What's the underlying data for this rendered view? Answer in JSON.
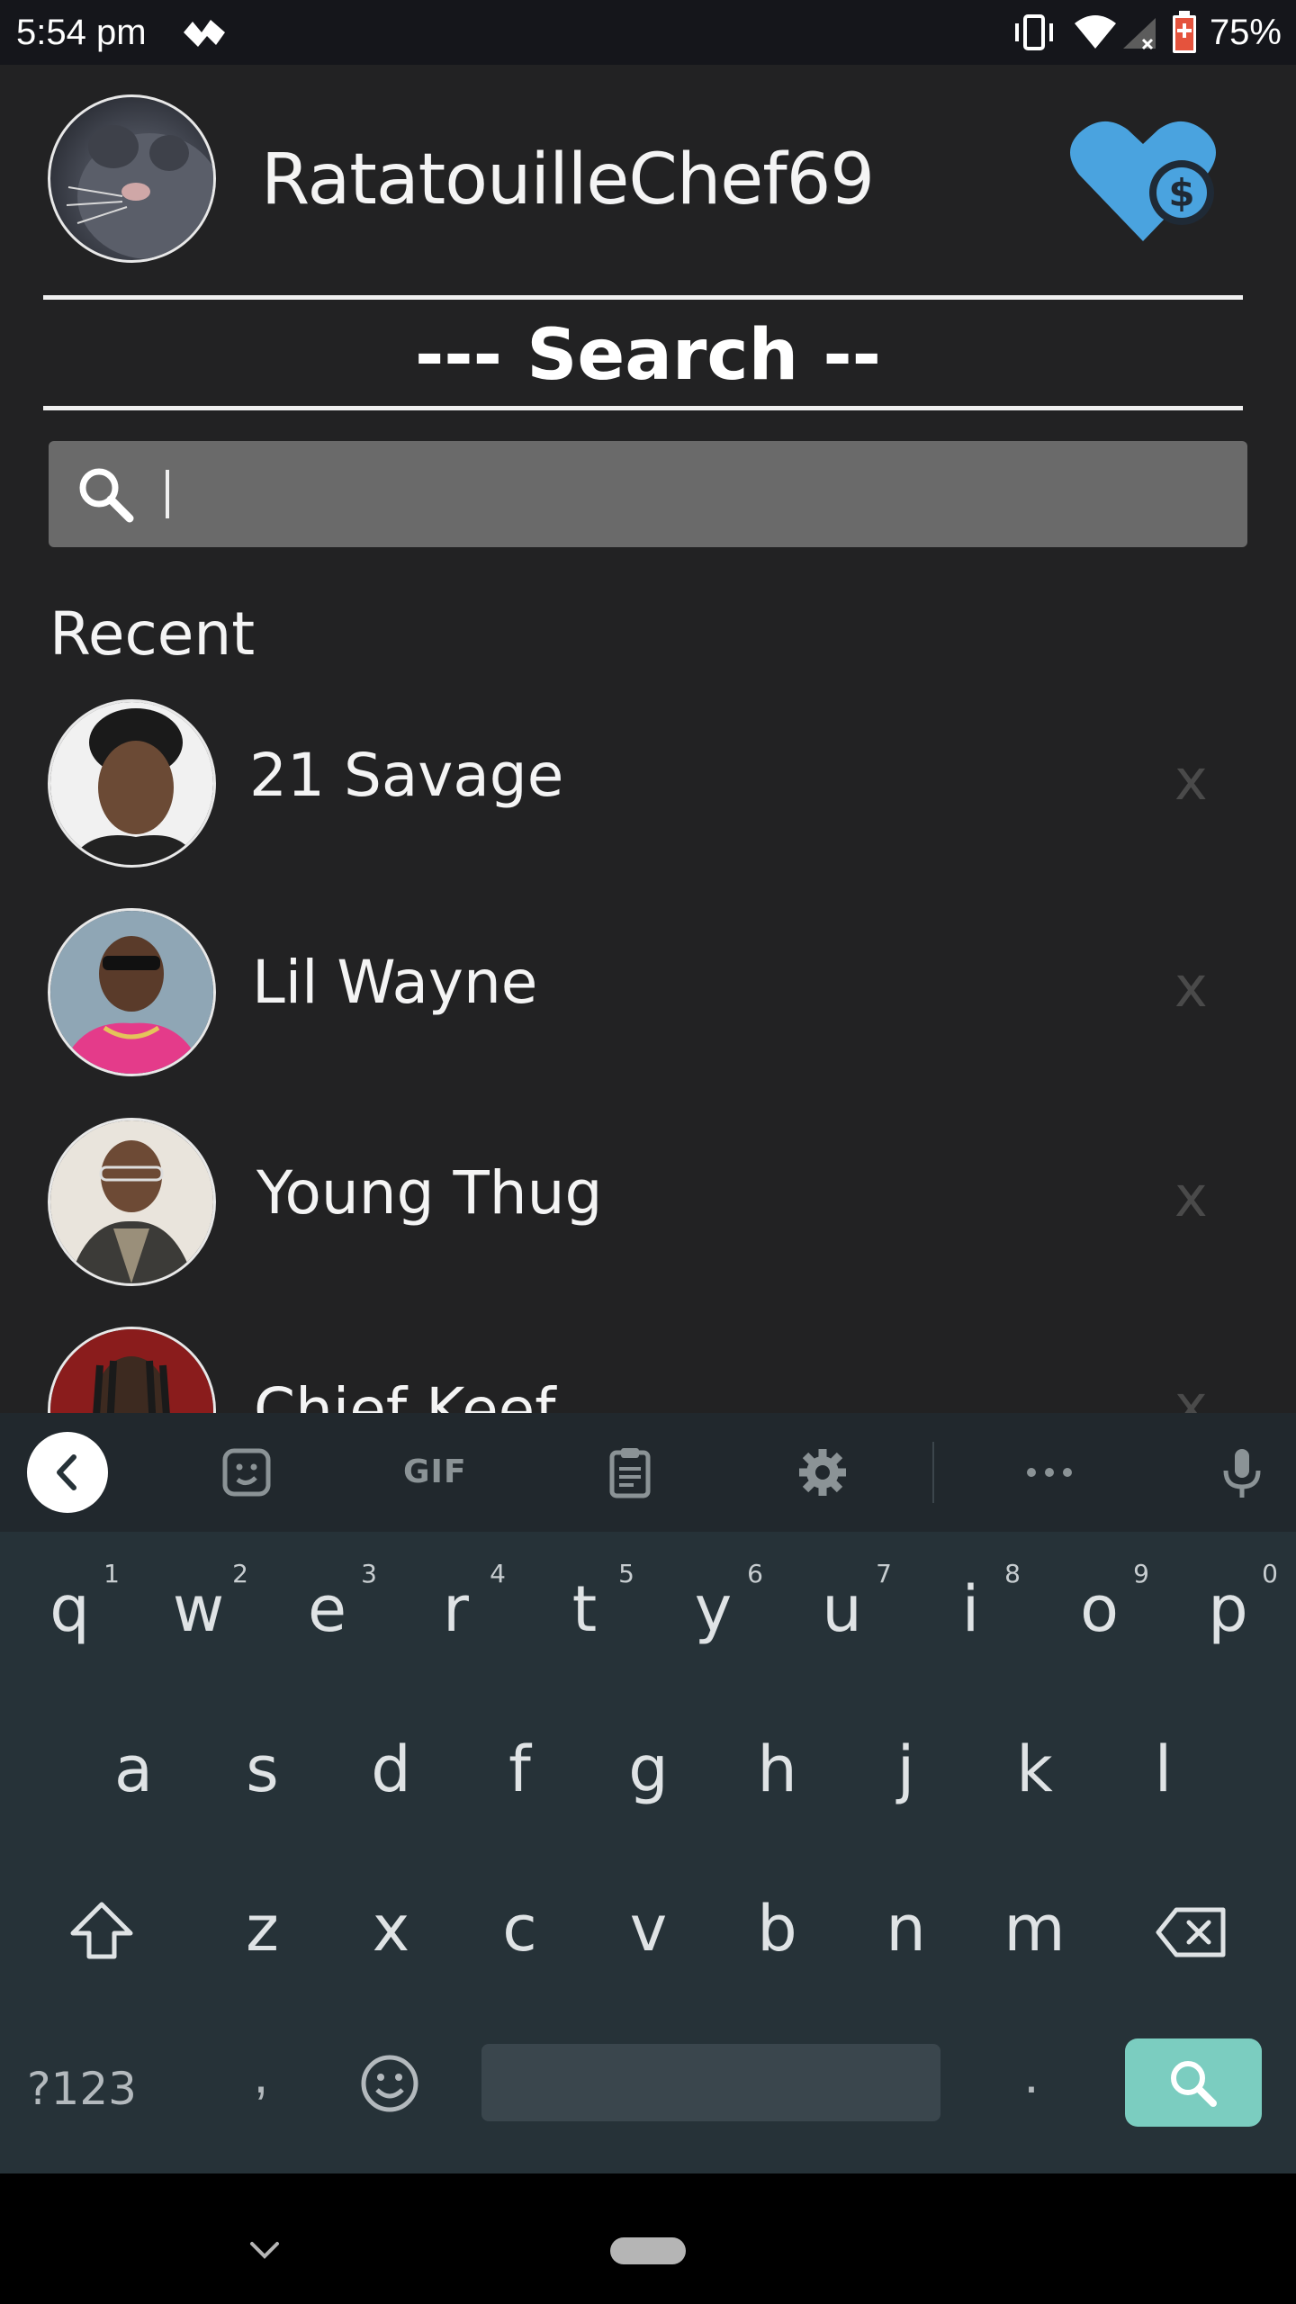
{
  "status_bar": {
    "time": "5:54 pm",
    "battery_percent": "75%",
    "icons": [
      "notification-icon",
      "vibrate-icon",
      "wifi-icon",
      "signal-icon",
      "battery-icon"
    ]
  },
  "header": {
    "username": "RatatouilleChef69",
    "donate_icon": "heart-dollar-icon",
    "accent_color": "#4aa3df"
  },
  "search": {
    "heading": "--- Search --",
    "query": "",
    "icon": "search-icon"
  },
  "recent": {
    "label": "Recent",
    "items": [
      {
        "name": "21 Savage",
        "remove_label": "x"
      },
      {
        "name": "Lil Wayne",
        "remove_label": "x"
      },
      {
        "name": "Young Thug",
        "remove_label": "x"
      },
      {
        "name": "Chief Keef",
        "remove_label": "x"
      }
    ]
  },
  "keyboard": {
    "toolbar": {
      "gif_label": "GIF",
      "icons": [
        "back-chevron-icon",
        "sticker-icon",
        "gif-icon",
        "clipboard-icon",
        "settings-gear-icon",
        "more-dots-icon",
        "microphone-icon"
      ]
    },
    "row1": [
      "q",
      "w",
      "e",
      "r",
      "t",
      "y",
      "u",
      "i",
      "o",
      "p"
    ],
    "row1_hints": [
      "1",
      "2",
      "3",
      "4",
      "5",
      "6",
      "7",
      "8",
      "9",
      "0"
    ],
    "row2": [
      "a",
      "s",
      "d",
      "f",
      "g",
      "h",
      "j",
      "k",
      "l"
    ],
    "row3": [
      "z",
      "x",
      "c",
      "v",
      "b",
      "n",
      "m"
    ],
    "symbols_label": "?123",
    "comma_label": ",",
    "period_label": ".",
    "search_key_color": "#7bcdc0"
  }
}
